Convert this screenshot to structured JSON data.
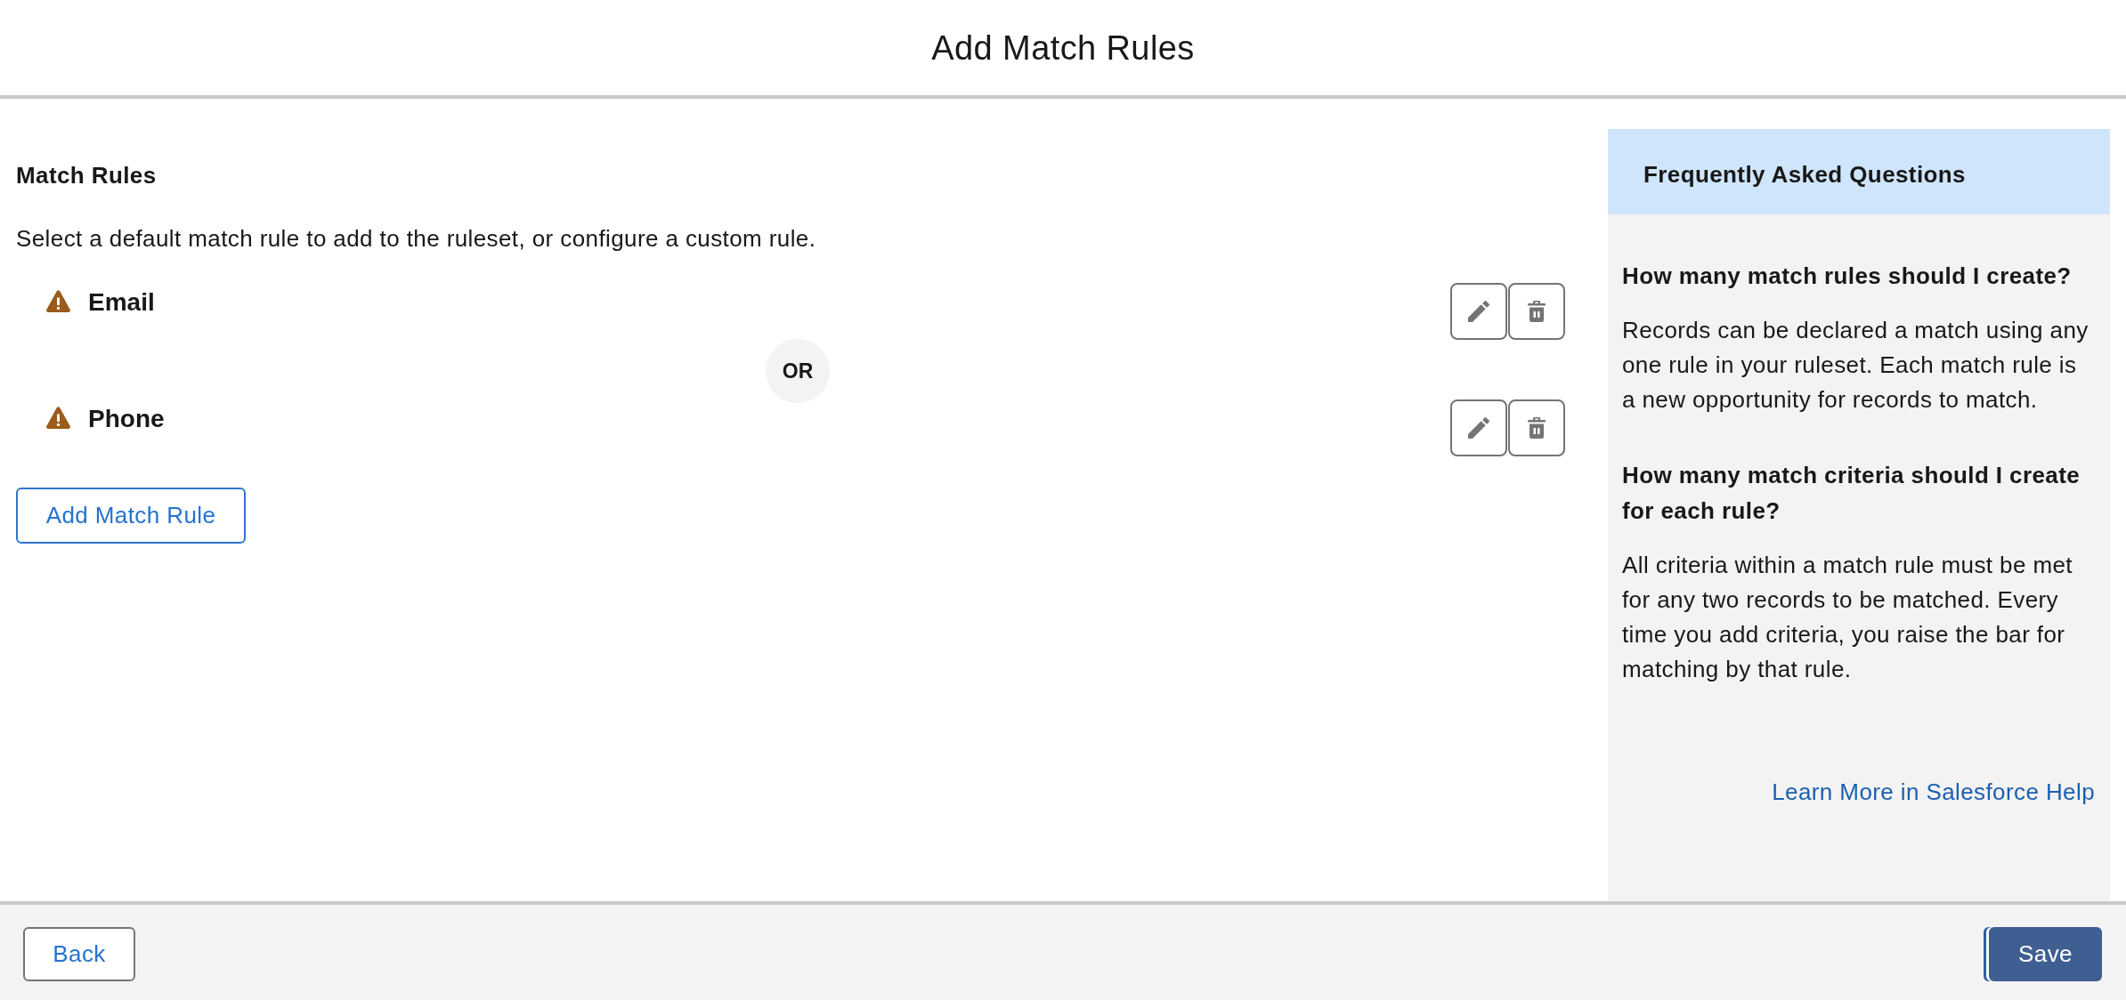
{
  "header": {
    "title": "Add Match Rules"
  },
  "match_rules": {
    "heading": "Match Rules",
    "description": "Select a default match rule to add to the ruleset, or configure a custom rule.",
    "rules": [
      {
        "name": "Email",
        "warning": true
      },
      {
        "name": "Phone",
        "warning": true,
        "connector": "OR"
      }
    ],
    "add_button": "Add Match Rule"
  },
  "faq": {
    "title": "Frequently Asked Questions",
    "items": [
      {
        "question": "How many match rules should I create?",
        "answer": "Records can be declared a match using any one rule in your ruleset. Each match rule is a new opportunity for records to match."
      },
      {
        "question": "How many match criteria should I create for each rule?",
        "answer": "All criteria within a match rule must be met for any two records to be matched. Every time you add criteria, you raise the bar for matching by that rule."
      }
    ],
    "link": "Learn More in Salesforce Help"
  },
  "footer": {
    "back_button": {
      "label": "Back"
    },
    "save_button": {
      "label": "Save",
      "focused": true
    }
  }
}
